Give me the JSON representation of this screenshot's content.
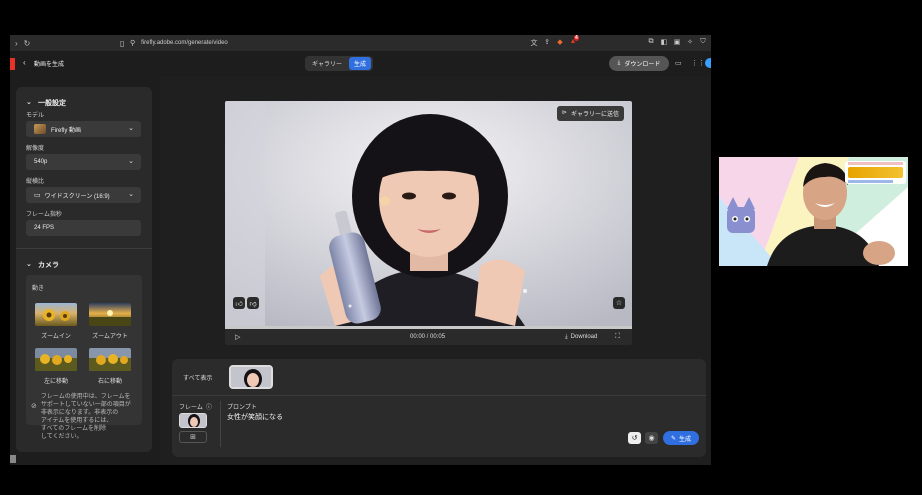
{
  "browser": {
    "url": "firefly.adobe.com/generate/video",
    "extension_badge": "4"
  },
  "app": {
    "title": "動画を生成",
    "tabs": [
      {
        "label": "ギャラリー",
        "active": false
      },
      {
        "label": "生成",
        "active": true
      }
    ],
    "download_button": "ダウンロード"
  },
  "sidebar": {
    "general_section": "一般設定",
    "model_label": "モデル",
    "model_value": "Firefly 動画",
    "resolution_label": "解像度",
    "resolution_value": "540p",
    "aspect_label": "縦横比",
    "aspect_value": "ワイドスクリーン (16:9)",
    "framerate_label": "フレーム指秒",
    "framerate_value": "24 FPS",
    "camera_section": "カメラ",
    "motion_label": "動き",
    "motions": [
      {
        "label": "ズームイン"
      },
      {
        "label": "ズームアウト"
      },
      {
        "label": "左に移動"
      },
      {
        "label": "右に移動"
      }
    ],
    "warning_lines": [
      "フレームの使用中は、フレームを",
      "サポートしていない一部の項目が",
      "非表示になります。非表示の",
      "アイテムを使用するには、",
      "すべてのフレームを削除",
      "してください。"
    ]
  },
  "preview": {
    "send_to_gallery": "ギャラリーに送信",
    "time": "00:00 / 00:05",
    "download": "Download"
  },
  "bottom": {
    "show_all": "すべて表示",
    "frame_label": "フレーム",
    "prompt_label": "プロンプト",
    "prompt_text": "女性が笑顔になる",
    "generate": "生成"
  },
  "colors": {
    "accent": "#2f6fe0",
    "adobe_red": "#e5332a",
    "panel": "#2a2a2a",
    "background": "#1d1d1d"
  }
}
